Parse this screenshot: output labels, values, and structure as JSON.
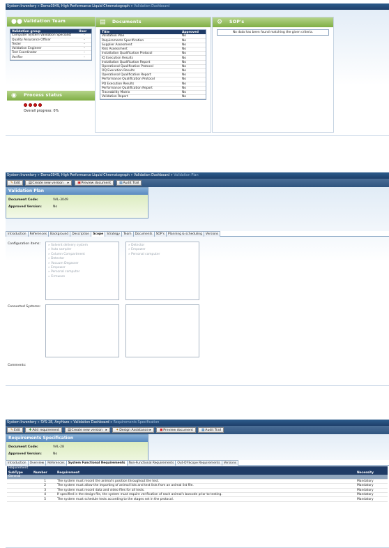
{
  "dashboard": {
    "breadcrumb": {
      "a": "System Inventory",
      "b": "Demo3049, High Performance Liquid Chromatograph",
      "c": "Validation Dashboard",
      "sep": " » "
    },
    "validation_team": {
      "title": "Validation Team",
      "col_group": "Validation group",
      "col_user": "User",
      "rows": [
        {
          "group": "Computer System Validation Specialist",
          "user": "-"
        },
        {
          "group": "Quality Assurance Officer",
          "user": "-"
        },
        {
          "group": "Tester",
          "user": "-"
        },
        {
          "group": "Validation Engineer",
          "user": "-"
        },
        {
          "group": "Test Coordinator",
          "user": "-"
        },
        {
          "group": "Verifier",
          "user": "-"
        }
      ]
    },
    "process_status": {
      "title": "Process status",
      "progress": "Overall progress: 0%",
      "progress_value": 0
    },
    "documents": {
      "title": "Documents",
      "col_title": "Title",
      "col_approved": "Approved",
      "rows": [
        {
          "title": "Validation Plan",
          "approved": "No"
        },
        {
          "title": "Requirements Specification",
          "approved": "No"
        },
        {
          "title": "Supplier Assesment",
          "approved": "No"
        },
        {
          "title": "Risk Assessment",
          "approved": "No"
        },
        {
          "title": "Installation Qualification Protocol",
          "approved": "No"
        },
        {
          "title": "IQ Execution Results",
          "approved": "No"
        },
        {
          "title": "Installation Qualification Report",
          "approved": "No"
        },
        {
          "title": "Operational Qualification Protocol",
          "approved": "No"
        },
        {
          "title": "OQ Execution Results",
          "approved": "No"
        },
        {
          "title": "Operational Qualification Report",
          "approved": "No"
        },
        {
          "title": "Performance Qualification Protocol",
          "approved": "No"
        },
        {
          "title": "PQ Execution Results",
          "approved": "No"
        },
        {
          "title": "Performance Qualification Report",
          "approved": "No"
        },
        {
          "title": "Traceability Matrix",
          "approved": "No"
        },
        {
          "title": "Validation Report",
          "approved": "No"
        }
      ]
    },
    "sops": {
      "title": "SOP's",
      "empty": "No data has been found matching the given criteria."
    }
  },
  "plan": {
    "breadcrumb": {
      "a": "System Inventory",
      "b": "Demo3049, High Performance Liquid Chromatograph",
      "c": "Validation Dashboard",
      "d": "Validation Plan",
      "sep": " » "
    },
    "toolbar": {
      "edit": "Edit",
      "create": "Create new version",
      "preview": "Preview document",
      "audit": "Audit Trail"
    },
    "box": {
      "title": "Validation Plan",
      "code_label": "Document Code:",
      "code": "VAL-3049",
      "ver_label": "Approved Version:",
      "ver": "No"
    },
    "tabs": [
      "Introduction",
      "References",
      "Background",
      "Description",
      "Scope",
      "Strategy",
      "Team",
      "Documents",
      "SOP's",
      "Planning & scheduling",
      "Versions"
    ],
    "active_tab": "Scope",
    "config_label": "Configuration items:",
    "config_left": [
      "Solvent delivery system",
      "Auto sampler",
      "Column Compartment",
      "Detector",
      "Vacuum Degasser",
      "Empower",
      "Personal computer",
      "Firmware"
    ],
    "config_right": [
      "Detector",
      "Empower",
      "Personal computer"
    ],
    "connected_label": "Connected Systems:",
    "comments_label": "Comments:"
  },
  "reqspec": {
    "breadcrumb": {
      "a": "System Inventory",
      "b": "SYS-28, AnyHaze",
      "c": "Validation Dashboard",
      "d": "Requirements Specification",
      "sep": " » "
    },
    "toolbar": {
      "edit": "Edit",
      "add": "Add requirement",
      "create": "Create new version",
      "assist": "Design Assistance",
      "preview": "Preview document",
      "audit": "Audit Trail"
    },
    "box": {
      "title": "Requirements Specification",
      "code_label": "Document Code:",
      "code": "VAL-28",
      "ver_label": "Approved Version:",
      "ver": "No"
    },
    "tabs": [
      "Introduction",
      "Overview",
      "References",
      "System Functional Requirements",
      "Non-Functional Requirements",
      "Out-Of-Scope Requirements",
      "Versions"
    ],
    "active_tab": "System Functional Requirements",
    "table": {
      "caption": "Requirement",
      "cols": [
        "SubType",
        "Number",
        "Requirement",
        "Necessity"
      ],
      "group": "General",
      "rows": [
        {
          "n": "1",
          "text": "The system must record the animal's position throughout the test.",
          "nec": "Mandatory"
        },
        {
          "n": "2",
          "text": "The system must allow the importing of animal lists and test lists from an animal list file.",
          "nec": "Mandatory"
        },
        {
          "n": "3",
          "text": "The system must record data and video files for all tests.",
          "nec": "Mandatory"
        },
        {
          "n": "4",
          "text": "If specified in the design file, the system must require verification of each animal's barcode prior to testing.",
          "nec": "Mandatory"
        },
        {
          "n": "5",
          "text": "The system must schedule tests according to the stages set in the protocol.",
          "nec": "Mandatory"
        }
      ]
    }
  }
}
